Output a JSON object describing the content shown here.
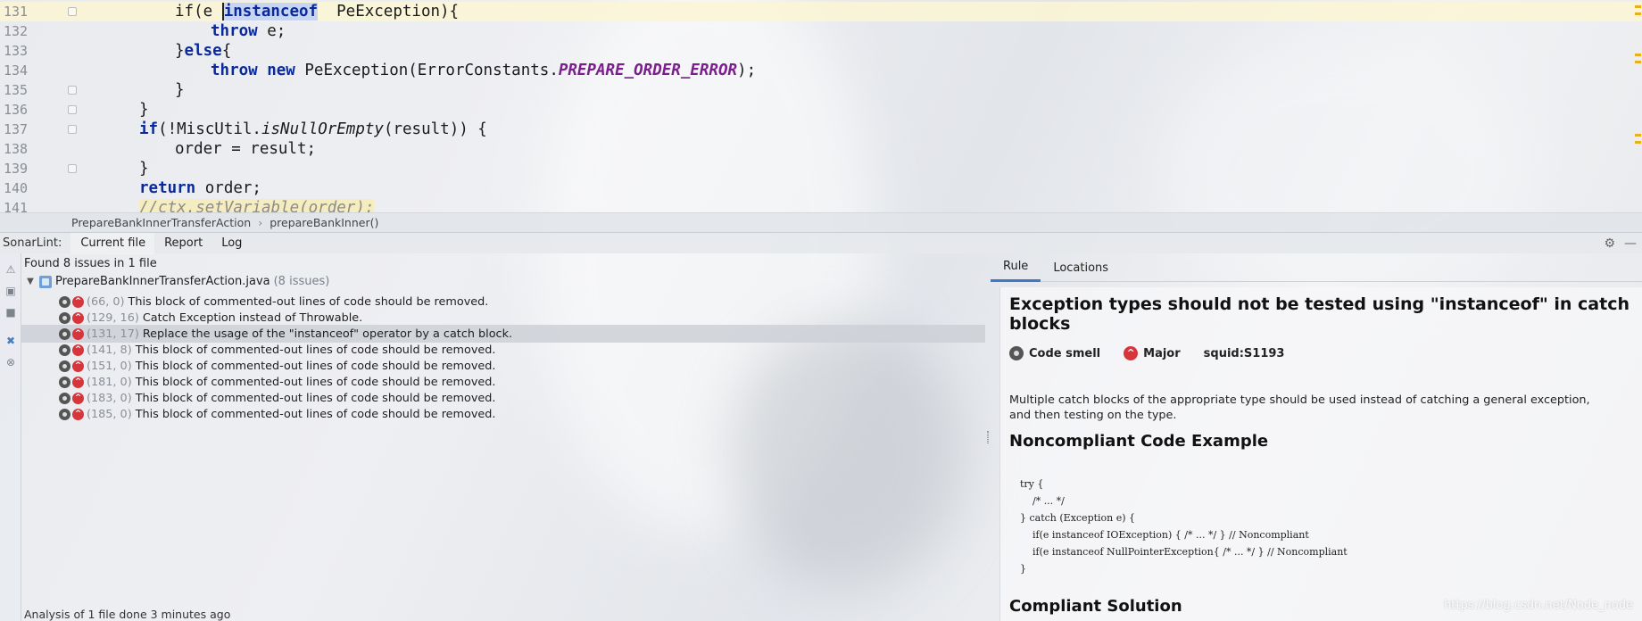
{
  "editor": {
    "lines": [
      {
        "num": "131",
        "indent": 4
      },
      {
        "num": "132",
        "indent": 6
      },
      {
        "num": "133",
        "indent": 4
      },
      {
        "num": "134",
        "indent": 6
      },
      {
        "num": "135",
        "indent": 4
      },
      {
        "num": "136",
        "indent": 3
      },
      {
        "num": "137",
        "indent": 3
      },
      {
        "num": "138",
        "indent": 4
      },
      {
        "num": "139",
        "indent": 3
      },
      {
        "num": "140",
        "indent": 3
      },
      {
        "num": "141",
        "indent": 3
      }
    ],
    "code": {
      "l131_a": "if(e ",
      "l131_kw": "instanceof",
      "l131_b": "  PeException){",
      "l132_kw": "throw",
      "l132_b": " e;",
      "l133_a": "}",
      "l133_kw": "else",
      "l133_b": "{",
      "l134_kw1": "throw",
      "l134_kw2": "new",
      "l134_b": " PeException(ErrorConstants.",
      "l134_const": "PREPARE_ORDER_ERROR",
      "l134_c": ");",
      "l135": "}",
      "l136": "}",
      "l137_kw": "if",
      "l137_a": "(!MiscUtil.",
      "l137_it": "isNullOrEmpty",
      "l137_b": "(result)) {",
      "l138": "order = result;",
      "l139": "}",
      "l140_kw": "return",
      "l140_b": " order;",
      "l141": "//ctx.setVariable(order);"
    },
    "breadcrumb": [
      "PrepareBankInnerTransferAction",
      "prepareBankInner()"
    ]
  },
  "tool": {
    "title": "SonarLint:",
    "tabs": [
      "Current file",
      "Report",
      "Log"
    ],
    "found": "Found 8 issues in 1 file",
    "file_name": "PrepareBankInnerTransferAction.java",
    "file_count": "(8 issues)",
    "issues": [
      {
        "loc": "(66, 0)",
        "text": "This block of commented-out lines of code should be removed."
      },
      {
        "loc": "(129, 16)",
        "text": "Catch Exception instead of Throwable."
      },
      {
        "loc": "(131, 17)",
        "text": "Replace the usage of the \"instanceof\" operator by a catch block."
      },
      {
        "loc": "(141, 8)",
        "text": "This block of commented-out lines of code should be removed."
      },
      {
        "loc": "(151, 0)",
        "text": "This block of commented-out lines of code should be removed."
      },
      {
        "loc": "(181, 0)",
        "text": "This block of commented-out lines of code should be removed."
      },
      {
        "loc": "(183, 0)",
        "text": "This block of commented-out lines of code should be removed."
      },
      {
        "loc": "(185, 0)",
        "text": "This block of commented-out lines of code should be removed."
      }
    ],
    "status": "Analysis of 1 file done 3 minutes ago"
  },
  "rule": {
    "tabs": [
      "Rule",
      "Locations"
    ],
    "title": "Exception types should not be tested using \"instanceof\" in catch blocks",
    "type": "Code smell",
    "severity": "Major",
    "key": "squid:S1193",
    "description": "Multiple catch blocks of the appropriate type should be used instead of catching a general exception, and then testing on the type.",
    "noncompliant_heading": "Noncompliant Code Example",
    "noncompliant_code": "try {\n    /* ... */\n} catch (Exception e) {\n    if(e instanceof IOException) { /* ... */ } // Noncompliant\n    if(e instanceof NullPointerException{ /* ... */ } // Noncompliant\n}",
    "compliant_heading": "Compliant Solution"
  },
  "watermark": "https://blog.csdn.net/Node_node",
  "colors": {
    "keyword": "#0a2a9c",
    "constant": "#7a1f8d",
    "severity_major": "#d6363b",
    "current_line": "#fcf6d4",
    "active_tab": "#3f79c8"
  }
}
